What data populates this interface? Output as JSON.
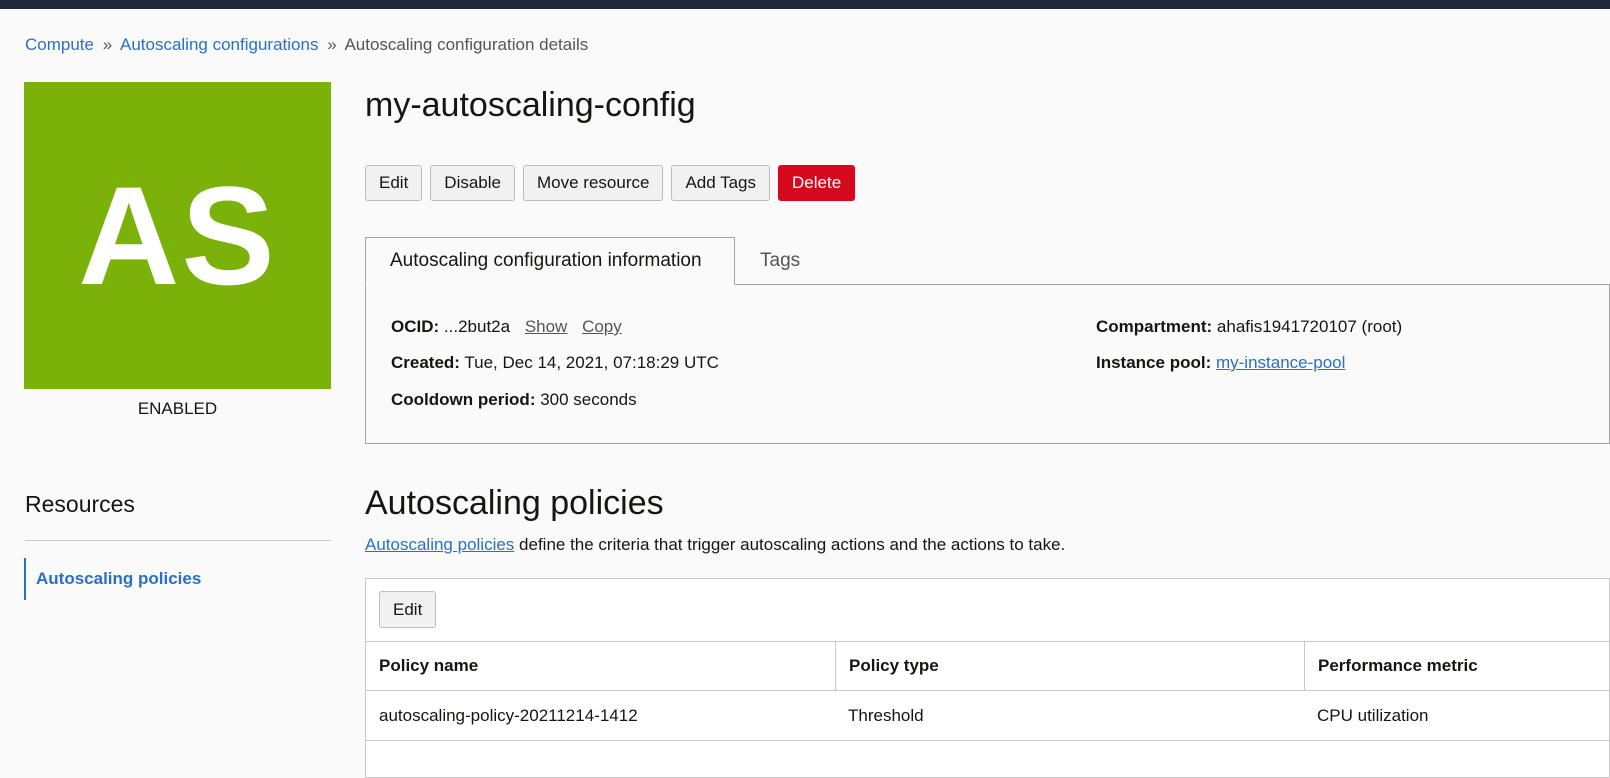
{
  "breadcrumb": {
    "items": [
      "Compute",
      "Autoscaling configurations"
    ],
    "current": "Autoscaling configuration details",
    "separator": "»"
  },
  "resource": {
    "avatar_text": "AS",
    "avatar_color": "#7ab20a",
    "status": "ENABLED",
    "title": "my-autoscaling-config"
  },
  "actions": {
    "edit": "Edit",
    "disable": "Disable",
    "move": "Move resource",
    "add_tags": "Add Tags",
    "delete": "Delete"
  },
  "tabs": {
    "info": "Autoscaling configuration information",
    "tags": "Tags"
  },
  "info": {
    "ocid_label": "OCID:",
    "ocid_value": "...2but2a",
    "show": "Show",
    "copy": "Copy",
    "created_label": "Created:",
    "created_value": "Tue, Dec 14, 2021, 07:18:29 UTC",
    "cooldown_label": "Cooldown period:",
    "cooldown_value": "300 seconds",
    "compartment_label": "Compartment:",
    "compartment_value": "ahafis1941720107 (root)",
    "pool_label": "Instance pool:",
    "pool_value": "my-instance-pool"
  },
  "resources": {
    "title": "Resources",
    "items": [
      "Autoscaling policies"
    ]
  },
  "policies": {
    "title": "Autoscaling policies",
    "desc_link": "Autoscaling policies",
    "desc_text": " define the criteria that trigger autoscaling actions and the actions to take.",
    "edit": "Edit",
    "columns": [
      "Policy name",
      "Policy type",
      "Performance metric"
    ],
    "rows": [
      [
        "autoscaling-policy-20211214-1412",
        "Threshold",
        "CPU utilization"
      ]
    ]
  },
  "colors": {
    "link": "#2a6fc9",
    "danger": "#d6081e",
    "topbar": "#1f2937"
  }
}
